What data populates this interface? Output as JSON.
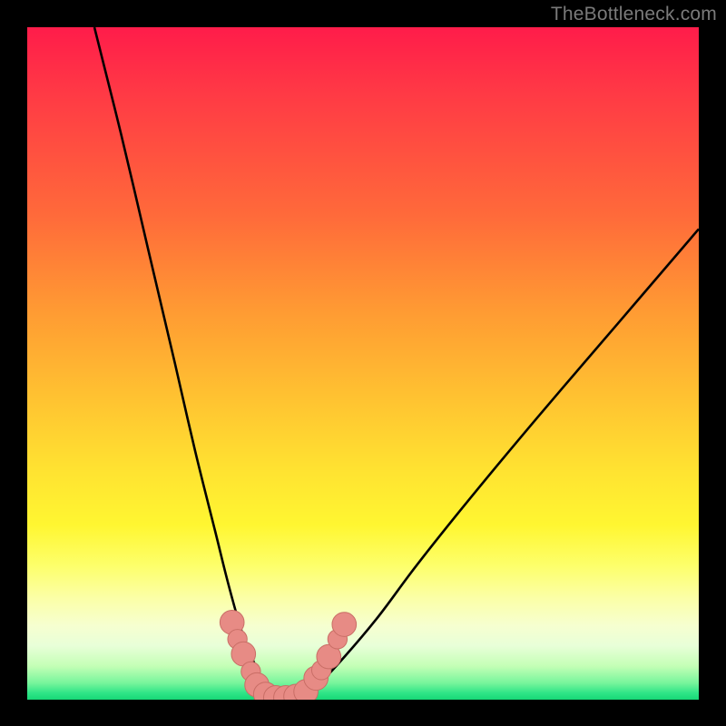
{
  "watermark": "TheBottleneck.com",
  "colors": {
    "frame": "#000000",
    "curve": "#000000",
    "marker_fill": "#e78b85",
    "marker_stroke": "#c96e66"
  },
  "chart_data": {
    "type": "line",
    "title": "",
    "xlabel": "",
    "ylabel": "",
    "ylim": [
      0,
      100
    ],
    "xlim": [
      0,
      100
    ],
    "series": [
      {
        "name": "bottleneck-curve",
        "x": [
          10,
          14,
          18,
          22,
          25,
          28,
          30,
          32,
          34,
          36,
          38,
          40,
          42,
          46,
          52,
          58,
          66,
          76,
          88,
          100
        ],
        "y": [
          100,
          84,
          67,
          50,
          37,
          25,
          17,
          10,
          5,
          1,
          0,
          0,
          1,
          5,
          12,
          20,
          30,
          42,
          56,
          70
        ]
      }
    ],
    "markers": [
      {
        "x": 30.5,
        "y": 11.5,
        "r": 1.4
      },
      {
        "x": 31.3,
        "y": 9.0,
        "r": 1.0
      },
      {
        "x": 32.2,
        "y": 6.8,
        "r": 1.4
      },
      {
        "x": 33.3,
        "y": 4.2,
        "r": 1.0
      },
      {
        "x": 34.2,
        "y": 2.2,
        "r": 1.4
      },
      {
        "x": 35.5,
        "y": 0.8,
        "r": 1.4
      },
      {
        "x": 37.0,
        "y": 0.3,
        "r": 1.4
      },
      {
        "x": 38.5,
        "y": 0.3,
        "r": 1.4
      },
      {
        "x": 40.0,
        "y": 0.5,
        "r": 1.4
      },
      {
        "x": 41.5,
        "y": 1.2,
        "r": 1.4
      },
      {
        "x": 43.0,
        "y": 3.2,
        "r": 1.4
      },
      {
        "x": 43.8,
        "y": 4.4,
        "r": 1.0
      },
      {
        "x": 44.9,
        "y": 6.4,
        "r": 1.4
      },
      {
        "x": 46.2,
        "y": 9.0,
        "r": 1.0
      },
      {
        "x": 47.2,
        "y": 11.2,
        "r": 1.4
      }
    ]
  }
}
